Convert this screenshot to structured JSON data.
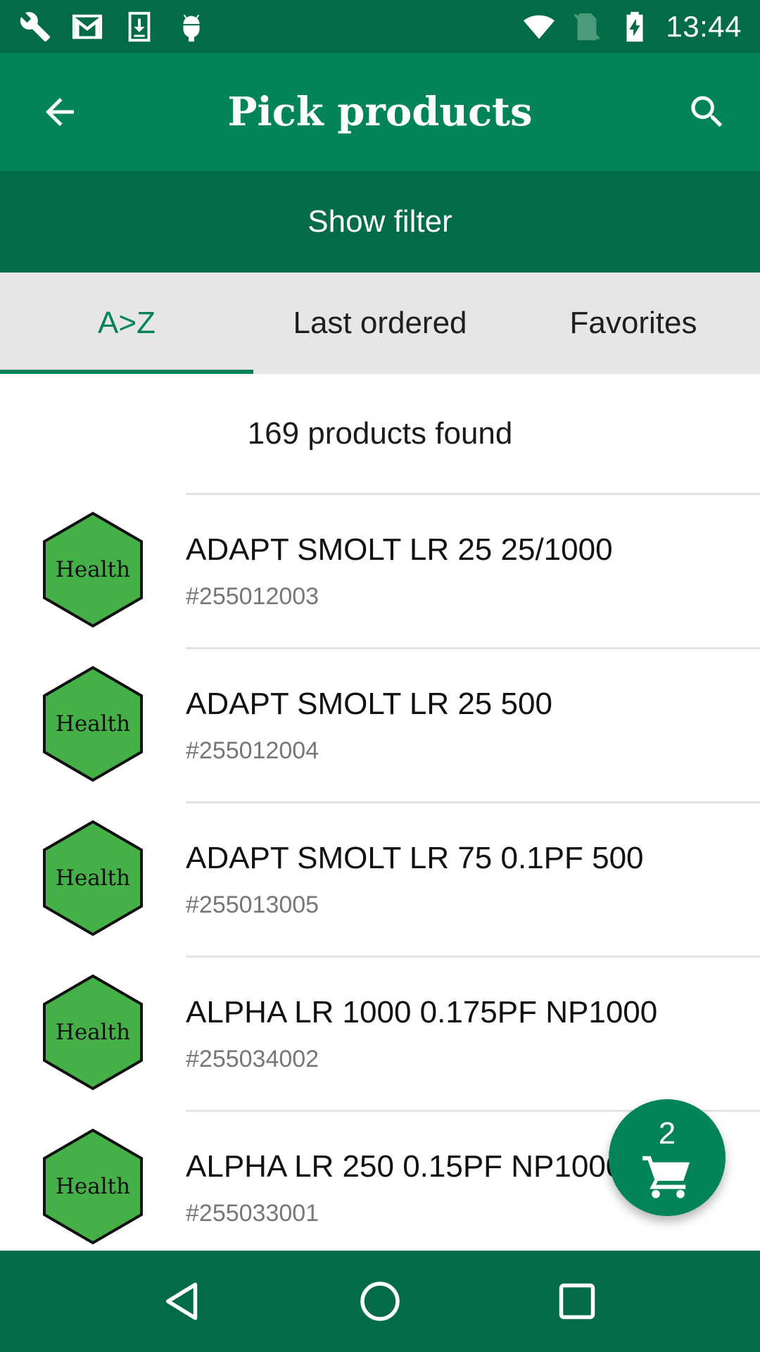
{
  "status_bar": {
    "time": "13:44",
    "left_icons": [
      "wrench-icon",
      "gmail-icon",
      "download-icon",
      "android-icon"
    ],
    "right_icons": [
      "wifi-icon",
      "no-sim-icon",
      "battery-charging-icon"
    ]
  },
  "app_bar": {
    "title": "Pick products",
    "back_icon": "arrow-back-icon",
    "search_icon": "search-icon"
  },
  "filter": {
    "label": "Show filter"
  },
  "tabs": [
    {
      "label": "A>Z",
      "active": true
    },
    {
      "label": "Last ordered",
      "active": false
    },
    {
      "label": "Favorites",
      "active": false
    }
  ],
  "results": {
    "count_text": "169 products found"
  },
  "products": [
    {
      "badge": "Health",
      "name": "ADAPT SMOLT LR 25 25/1000",
      "sku": "#255012003"
    },
    {
      "badge": "Health",
      "name": "ADAPT SMOLT LR 25 500",
      "sku": "#255012004"
    },
    {
      "badge": "Health",
      "name": "ADAPT SMOLT LR 75 0.1PF 500",
      "sku": "#255013005"
    },
    {
      "badge": "Health",
      "name": "ALPHA LR 1000 0.175PF NP1000",
      "sku": "#255034002"
    },
    {
      "badge": "Health",
      "name": "ALPHA LR 250 0.15PF NP1000",
      "sku": "#255033001"
    }
  ],
  "cart_fab": {
    "count": "2",
    "icon": "cart-icon"
  },
  "colors": {
    "primary": "#028458",
    "primary_dark": "#046b47",
    "badge_fill": "#46b048"
  }
}
